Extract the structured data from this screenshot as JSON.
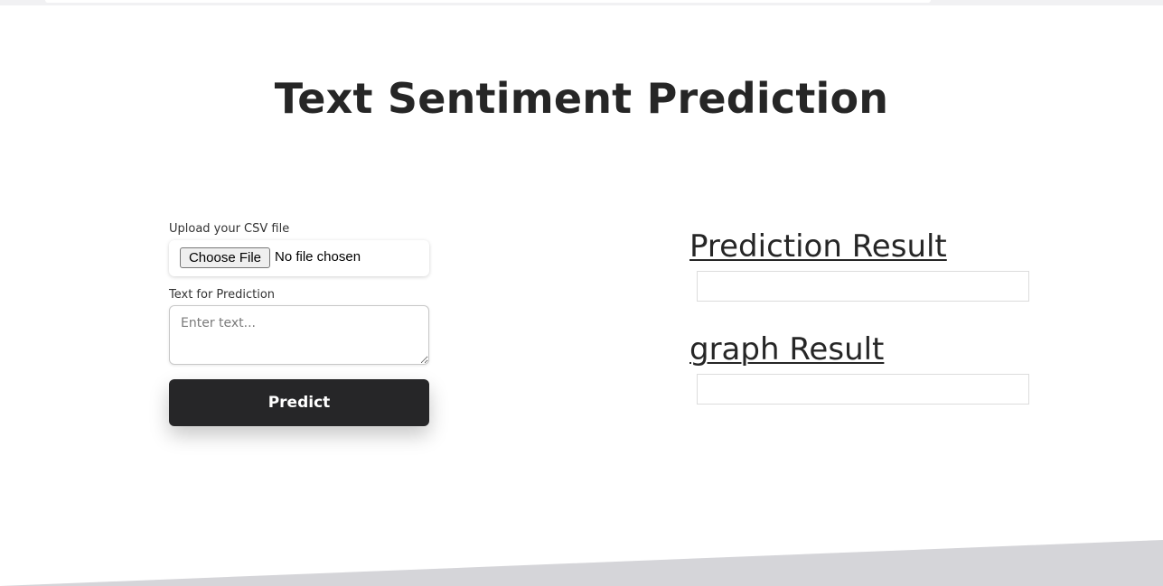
{
  "header": {
    "title": "Text Sentiment Prediction"
  },
  "form": {
    "upload_label": "Upload your CSV file",
    "choose_file_label": "Choose File",
    "file_status": "No file chosen",
    "text_label": "Text for Prediction",
    "text_value": "",
    "text_placeholder": "Enter text...",
    "predict_label": "Predict"
  },
  "results": {
    "prediction_heading": "Prediction Result",
    "prediction_value": "",
    "graph_heading": "graph Result",
    "graph_value": ""
  },
  "colors": {
    "button_bg": "#262628",
    "text": "#262626",
    "footer_band": "#d5d5d9"
  }
}
